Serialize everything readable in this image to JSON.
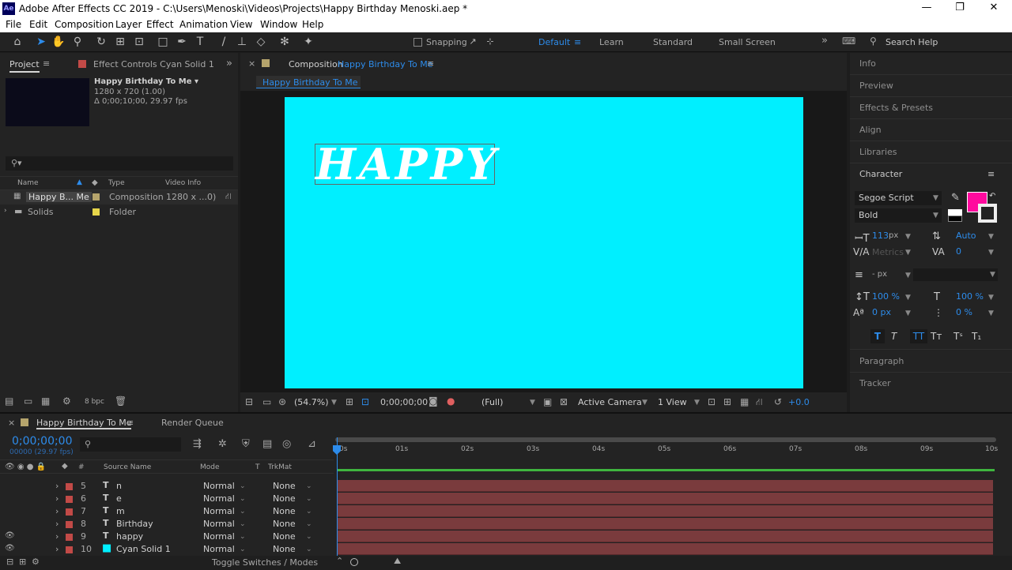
{
  "window": {
    "title": "Adobe After Effects CC 2019 - C:\\Users\\Menoski\\Videos\\Projects\\Happy Birthday Menoski.aep *",
    "logo": "Ae",
    "min": "—",
    "max": "❐",
    "close": "✕"
  },
  "menu": [
    "File",
    "Edit",
    "Composition",
    "Layer",
    "Effect",
    "Animation",
    "View",
    "Window",
    "Help"
  ],
  "toolbar": {
    "snapping": "Snapping",
    "workspaces": [
      "Default",
      "Learn",
      "Standard",
      "Small Screen"
    ],
    "search": "Search Help"
  },
  "project": {
    "tab": "Project",
    "effect_tab": "Effect Controls Cyan Solid 1",
    "item_name": "Happy Birthday To Me ▾",
    "item_size": "1280 x 720 (1.00)",
    "item_duration": "Δ 0;00;10;00, 29.97 fps",
    "cols": {
      "name": "Name",
      "type": "Type",
      "video": "Video Info"
    },
    "rows": [
      {
        "name": "Happy B... Me",
        "type": "Composition",
        "info": "1280 x ...0)",
        "color": "#b5a46c"
      },
      {
        "name": "Solids",
        "type": "Folder",
        "info": "",
        "color": "#e6d54a"
      }
    ],
    "bpc": "8 bpc"
  },
  "comp": {
    "tab_prefix": "Composition",
    "tab_name": "Happy Birthday To Me",
    "subtab": "Happy Birthday To Me",
    "canvas_text": "HAPPY",
    "canvas_color": "#00efff",
    "zoom": "(54.7%)",
    "time": "0;00;00;00",
    "resolution": "(Full)",
    "camera": "Active Camera",
    "view": "1 View",
    "exposure": "+0.0"
  },
  "right": {
    "panels": [
      "Info",
      "Preview",
      "Effects & Presets",
      "Align",
      "Libraries"
    ],
    "character": "Character",
    "font": "Segoe Script",
    "style": "Bold",
    "size": "113",
    "size_unit": "px",
    "leading": "Auto",
    "kerning": "Metrics",
    "tracking": "0",
    "stroke": "- px",
    "vscale": "100 %",
    "hscale": "100 %",
    "baseline": "0 px",
    "tsume": "0 %",
    "fill_color": "#ff0a9e",
    "paragraph": "Paragraph",
    "tracker": "Tracker"
  },
  "timeline": {
    "tab": "Happy Birthday To Me",
    "render": "Render Queue",
    "timecode": "0;00;00;00",
    "frames": "00000 (29.97 fps)",
    "cols": {
      "num": "#",
      "src": "Source Name",
      "mode": "Mode",
      "t": "T",
      "trk": "TrkMat"
    },
    "ticks": [
      "0s",
      "01s",
      "02s",
      "03s",
      "04s",
      "05s",
      "06s",
      "07s",
      "08s",
      "09s",
      "10s"
    ],
    "layers": [
      {
        "num": "5",
        "type": "T",
        "name": "n",
        "mode": "Normal",
        "trk": "None",
        "color": "#c24a47"
      },
      {
        "num": "6",
        "type": "T",
        "name": "e",
        "mode": "Normal",
        "trk": "None",
        "color": "#c24a47"
      },
      {
        "num": "7",
        "type": "T",
        "name": "m",
        "mode": "Normal",
        "trk": "None",
        "color": "#c24a47"
      },
      {
        "num": "8",
        "type": "T",
        "name": "Birthday",
        "mode": "Normal",
        "trk": "None",
        "color": "#c24a47"
      },
      {
        "num": "9",
        "type": "T",
        "name": "happy",
        "mode": "Normal",
        "trk": "None",
        "color": "#c24a47"
      },
      {
        "num": "10",
        "type": "■",
        "name": "Cyan Solid 1",
        "mode": "Normal",
        "trk": "None",
        "color": "#c24a47"
      }
    ],
    "toggle": "Toggle Switches / Modes"
  }
}
